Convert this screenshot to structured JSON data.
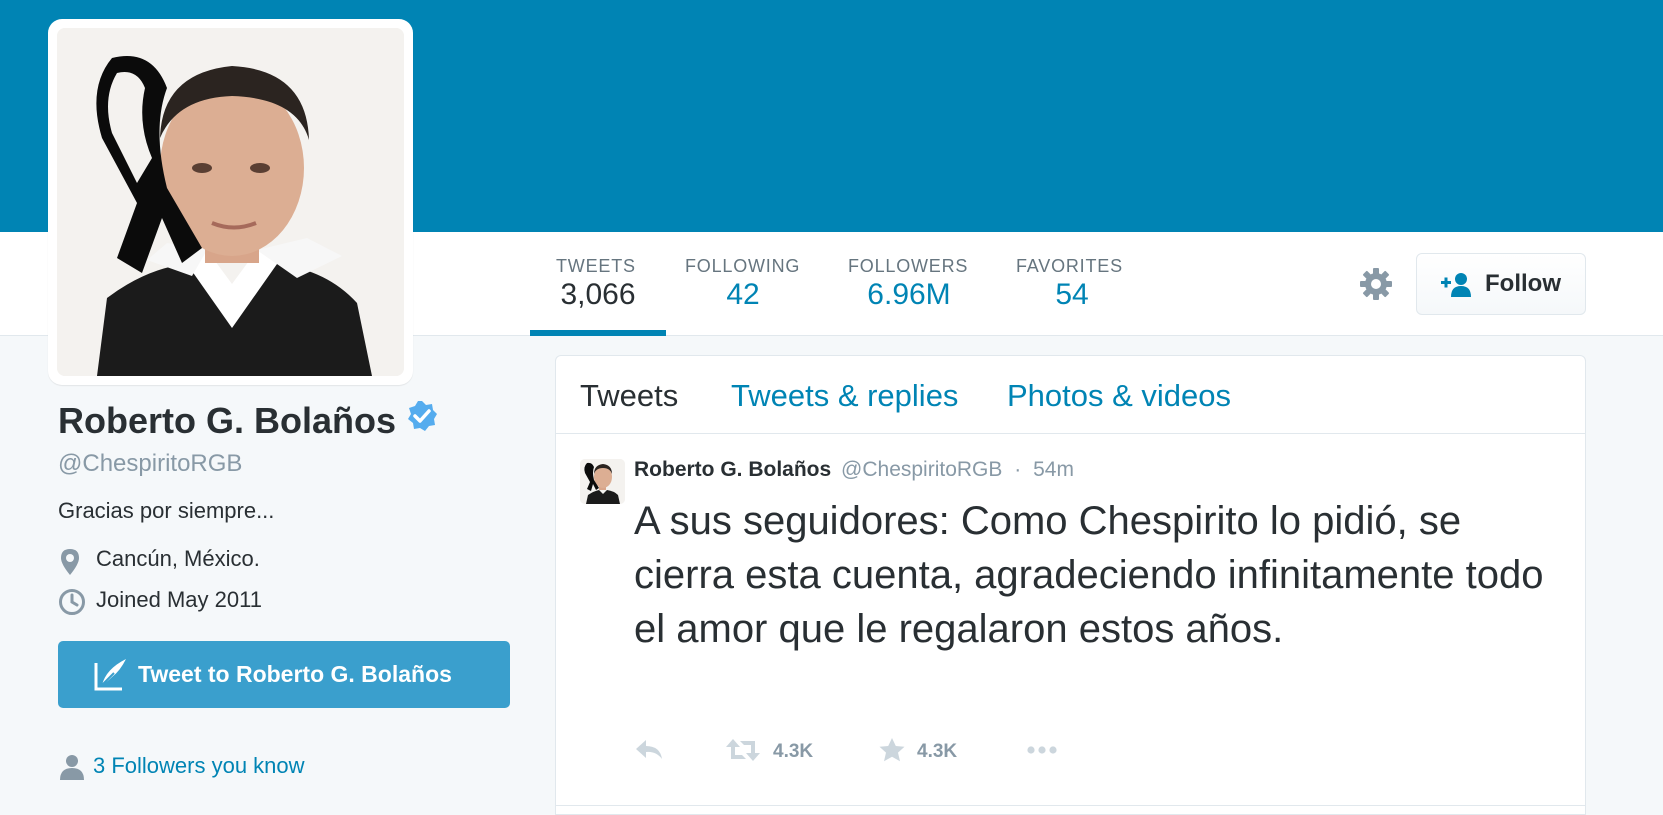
{
  "colors": {
    "banner": "#0084b4",
    "accent": "#0084b4",
    "tweet_to_button": "#3a9fcd",
    "muted": "#8899a6",
    "text": "#292f33"
  },
  "profile": {
    "name": "Roberto G. Bolaños",
    "verified": true,
    "handle": "@ChespiritoRGB",
    "bio": "Gracias por siempre...",
    "location": "Cancún, México.",
    "joined": "Joined May 2011",
    "tweet_to_label": "Tweet to Roberto G. Bolaños",
    "followers_you_know": "3 Followers you know"
  },
  "stats": [
    {
      "label": "TWEETS",
      "value": "3,066",
      "active": true
    },
    {
      "label": "FOLLOWING",
      "value": "42",
      "active": false
    },
    {
      "label": "FOLLOWERS",
      "value": "6.96M",
      "active": false
    },
    {
      "label": "FAVORITES",
      "value": "54",
      "active": false
    }
  ],
  "actions": {
    "settings_icon": "gear-icon",
    "follow_label": "Follow"
  },
  "tabs": [
    {
      "label": "Tweets",
      "active": true
    },
    {
      "label": "Tweets & replies",
      "active": false
    },
    {
      "label": "Photos & videos",
      "active": false
    }
  ],
  "tweet": {
    "author": "Roberto G. Bolaños",
    "handle": "@ChespiritoRGB",
    "separator": "·",
    "time": "54m",
    "text": "A sus seguidores: Como Chespirito lo pidió, se cierra esta cuenta, agradeciendo infinitamente todo el amor que le regalaron estos años.",
    "retweets": "4.3K",
    "favorites": "4.3K"
  }
}
